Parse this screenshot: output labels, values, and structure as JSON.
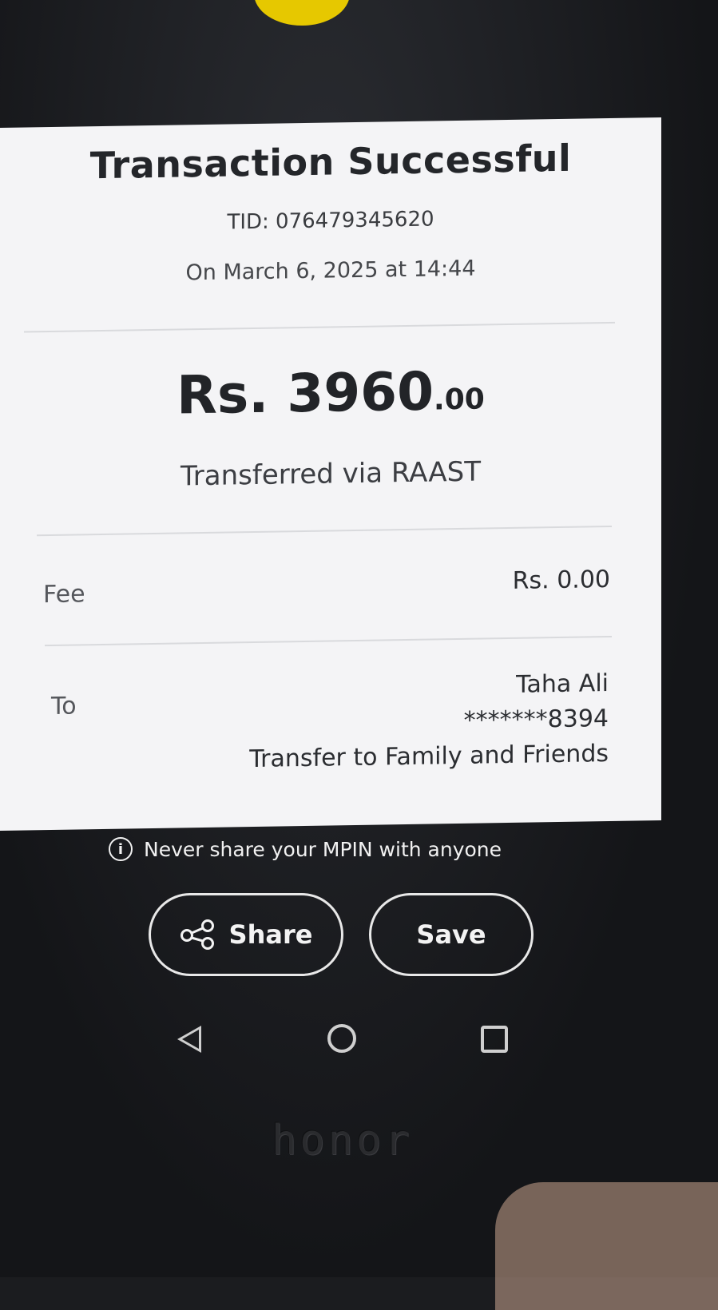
{
  "receipt": {
    "title": "Transaction Successful",
    "tid": "TID: 076479345620",
    "date": "On March 6, 2025 at 14:44",
    "amount_main": "Rs. 3960",
    "amount_cents": ".00",
    "transfer_method": "Transferred via RAAST",
    "fee_label": "Fee",
    "fee_value": "Rs. 0.00",
    "to_label": "To",
    "recipient_name": "Taha Ali",
    "recipient_account": "*******8394",
    "transfer_purpose": "Transfer to Family and Friends"
  },
  "notice": {
    "icon": "info-icon",
    "text": "Never share your MPIN with anyone"
  },
  "actions": {
    "share_label": "Share",
    "share_icon": "share-icon",
    "save_label": "Save"
  },
  "navbar": {
    "back_icon": "back-icon",
    "home_icon": "home-icon",
    "recent_icon": "recent-apps-icon"
  },
  "device": {
    "brand": "honor"
  },
  "colors": {
    "receipt_background": "#f4f4f6",
    "text_primary": "#2b2d31",
    "screen_background": "#1b1c1f",
    "button_border": "#e8e8e8"
  }
}
